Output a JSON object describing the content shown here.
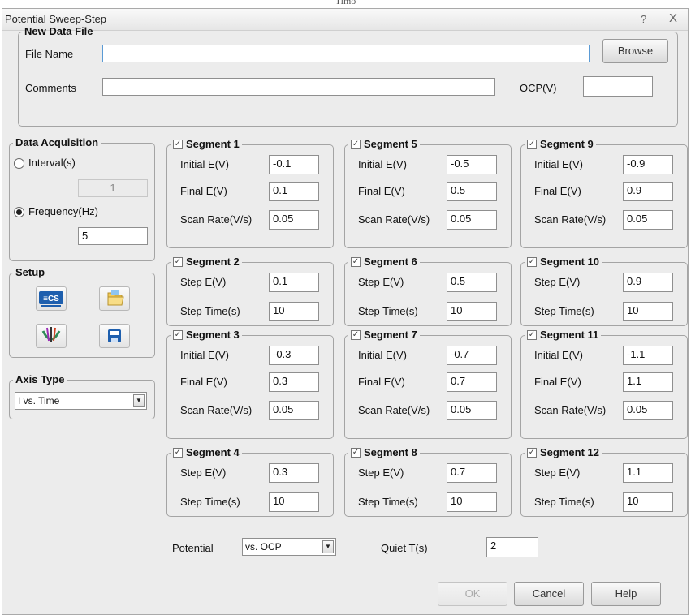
{
  "page_caption": "Timo",
  "window": {
    "title": "Potential Sweep-Step",
    "help_glyph": "?",
    "close_glyph": "X"
  },
  "new_data_file": {
    "legend": "New Data File",
    "file_name_label": "File Name",
    "file_name_value": "",
    "browse_label": "Browse",
    "comments_label": "Comments",
    "comments_value": "",
    "ocp_label": "OCP(V)",
    "ocp_value": ""
  },
  "data_acquisition": {
    "legend": "Data Acquisition",
    "interval_label": "Interval(s)",
    "interval_value": "1",
    "interval_selected": false,
    "frequency_label": "Frequency(Hz)",
    "frequency_value": "5",
    "frequency_selected": true
  },
  "setup": {
    "legend": "Setup",
    "cs_icon_text": "≡CS",
    "icons": [
      "cs-device-icon",
      "folder-open-icon",
      "electrode-icon",
      "save-disk-icon"
    ]
  },
  "axis_type": {
    "legend": "Axis Type",
    "selected": "I vs. Time"
  },
  "labels": {
    "initial_e": "Initial E(V)",
    "final_e": "Final E(V)",
    "scan_rate": "Scan Rate(V/s)",
    "step_e": "Step E(V)",
    "step_time": "Step Time(s)"
  },
  "segments": [
    {
      "title": "Segment 1",
      "checked": true,
      "type": "sweep",
      "initial_e": "-0.1",
      "final_e": "0.1",
      "scan_rate": "0.05"
    },
    {
      "title": "Segment 2",
      "checked": true,
      "type": "step",
      "step_e": "0.1",
      "step_time": "10"
    },
    {
      "title": "Segment 3",
      "checked": true,
      "type": "sweep",
      "initial_e": "-0.3",
      "final_e": "0.3",
      "scan_rate": "0.05"
    },
    {
      "title": "Segment 4",
      "checked": true,
      "type": "step",
      "step_e": "0.3",
      "step_time": "10"
    },
    {
      "title": "Segment 5",
      "checked": true,
      "type": "sweep",
      "initial_e": "-0.5",
      "final_e": "0.5",
      "scan_rate": "0.05"
    },
    {
      "title": "Segment 6",
      "checked": true,
      "type": "step",
      "step_e": "0.5",
      "step_time": "10"
    },
    {
      "title": "Segment 7",
      "checked": true,
      "type": "sweep",
      "initial_e": "-0.7",
      "final_e": "0.7",
      "scan_rate": "0.05"
    },
    {
      "title": "Segment 8",
      "checked": true,
      "type": "step",
      "step_e": "0.7",
      "step_time": "10"
    },
    {
      "title": "Segment 9",
      "checked": true,
      "type": "sweep",
      "initial_e": "-0.9",
      "final_e": "0.9",
      "scan_rate": "0.05"
    },
    {
      "title": "Segment 10",
      "checked": true,
      "type": "step",
      "step_e": "0.9",
      "step_time": "10"
    },
    {
      "title": "Segment 11",
      "checked": true,
      "type": "sweep",
      "initial_e": "-1.1",
      "final_e": "1.1",
      "scan_rate": "0.05"
    },
    {
      "title": "Segment 12",
      "checked": true,
      "type": "step",
      "step_e": "1.1",
      "step_time": "10"
    }
  ],
  "potential": {
    "label": "Potential",
    "selected": "vs. OCP"
  },
  "quiet": {
    "label": "Quiet T(s)",
    "value": "2"
  },
  "buttons": {
    "ok": "OK",
    "ok_enabled": false,
    "cancel": "Cancel",
    "help": "Help"
  }
}
